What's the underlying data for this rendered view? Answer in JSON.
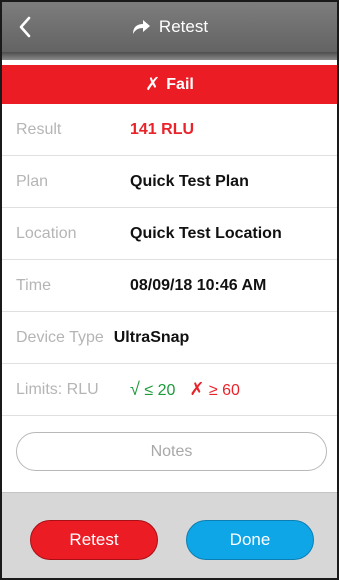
{
  "header": {
    "title": "Retest",
    "back_icon": "chevron-left-icon",
    "title_icon": "redo-arrow-icon"
  },
  "status_banner": {
    "icon": "✗",
    "text": "Fail",
    "color": "#ec1c24"
  },
  "details": {
    "result": {
      "label": "Result",
      "value": "141 RLU"
    },
    "plan": {
      "label": "Plan",
      "value": "Quick Test Plan"
    },
    "location": {
      "label": "Location",
      "value": "Quick Test Location"
    },
    "time": {
      "label": "Time",
      "value": "08/09/18 10:46 AM"
    },
    "device_type": {
      "label": "Device Type",
      "value": "UltraSnap"
    },
    "limits": {
      "label": "Limits: RLU",
      "pass_symbol": "√",
      "pass_text": "≤ 20",
      "fail_symbol": "✗",
      "fail_text": "≥ 60"
    }
  },
  "notes_button": {
    "label": "Notes"
  },
  "footer": {
    "retest_label": "Retest",
    "done_label": "Done"
  },
  "colors": {
    "fail_red": "#ec1c24",
    "pass_green": "#1d9a3a",
    "done_blue": "#0fa6e8",
    "header_gray": "#6e6e6e"
  }
}
